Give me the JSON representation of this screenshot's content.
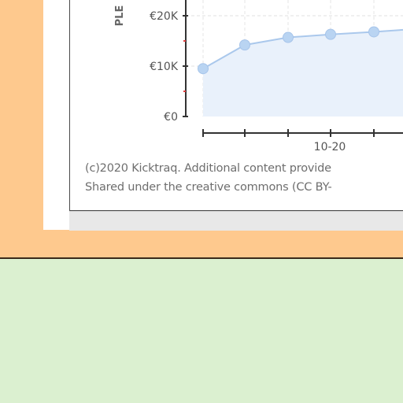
{
  "chart_data": {
    "type": "line",
    "ylabel": "PLE",
    "y_ticks": [
      "€20K",
      "€10K",
      "€0"
    ],
    "y_tick_values": [
      20000,
      10000,
      0
    ],
    "ylim": [
      0,
      25000
    ],
    "x_tick_label": "10-20",
    "series": [
      {
        "values": [
          9500,
          14200,
          15700,
          16300,
          16800,
          17200
        ]
      }
    ],
    "grid": true,
    "colors": {
      "line": "#aac8ec",
      "point": "#b9d4f2",
      "fill": "#e9f1fb"
    }
  },
  "credit": {
    "line1": "(c)2020 Kicktraq. Additional content provide",
    "line2": "Shared under the creative commons (CC BY-"
  }
}
